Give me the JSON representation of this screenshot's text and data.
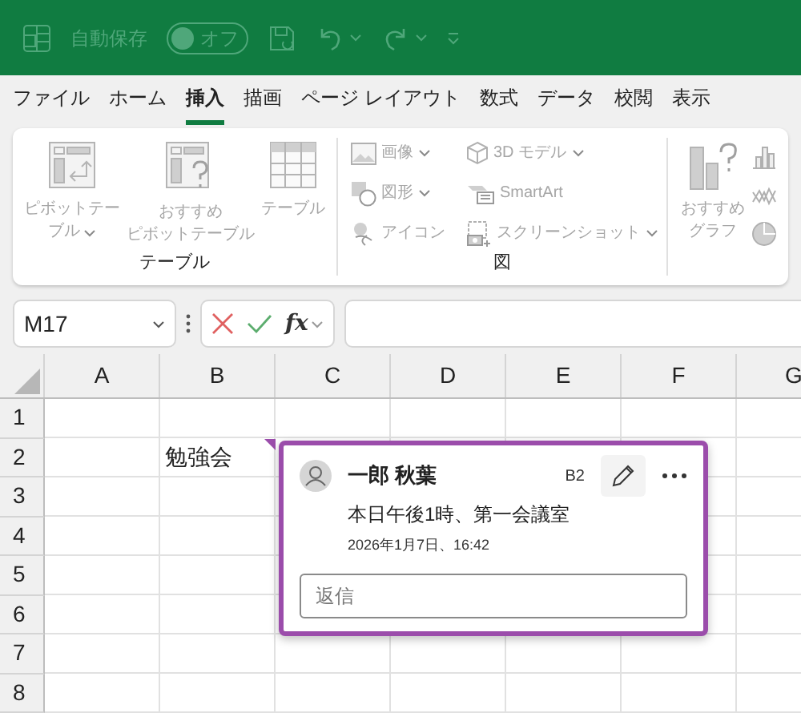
{
  "title_bar": {
    "autosave_label": "自動保存",
    "autosave_toggle": {
      "label": "オフ",
      "on": false
    }
  },
  "menu_tabs": [
    {
      "label": "ファイル",
      "selected": false
    },
    {
      "label": "ホーム",
      "selected": false
    },
    {
      "label": "挿入",
      "selected": true
    },
    {
      "label": "描画",
      "selected": false
    },
    {
      "label": "ページ レイアウト",
      "selected": false
    },
    {
      "label": "数式",
      "selected": false
    },
    {
      "label": "データ",
      "selected": false
    },
    {
      "label": "校閲",
      "selected": false
    },
    {
      "label": "表示",
      "selected": false
    }
  ],
  "ribbon": {
    "table_group": {
      "label": "テーブル",
      "buttons": [
        {
          "kind": "pivot",
          "lines": [
            "ピボットテー",
            "ブル"
          ],
          "dropdown": true,
          "disabled": true
        },
        {
          "kind": "recommended-pivot",
          "lines": [
            "おすすめ",
            "ピボットテーブル"
          ],
          "disabled": true
        },
        {
          "kind": "table",
          "lines": [
            "テーブル"
          ],
          "disabled": true
        }
      ]
    },
    "illustrations_group": {
      "label": "図",
      "items": [
        {
          "kind": "image",
          "label": "画像",
          "dropdown": true,
          "disabled": true
        },
        {
          "kind": "model",
          "label": "3D モデル",
          "dropdown": true,
          "disabled": true
        },
        {
          "kind": "shape",
          "label": "図形",
          "dropdown": true,
          "disabled": true
        },
        {
          "kind": "smartart",
          "label": "SmartArt",
          "disabled": true
        },
        {
          "kind": "icons",
          "label": "アイコン",
          "disabled": true
        },
        {
          "kind": "screenshot",
          "label": "スクリーンショット",
          "dropdown": true,
          "disabled": true
        }
      ]
    },
    "charts_group": {
      "recommended": {
        "lines": [
          "おすすめ",
          "グラフ"
        ],
        "disabled": true
      }
    }
  },
  "formula_bar": {
    "name_box": "M17",
    "function_label": "fx"
  },
  "sheet": {
    "columns": [
      "A",
      "B",
      "C",
      "D",
      "E",
      "F",
      "G"
    ],
    "rows": [
      {
        "label": "1",
        "cells": [
          "",
          "",
          "",
          "",
          "",
          "",
          ""
        ]
      },
      {
        "label": "2",
        "cells": [
          "",
          "勉強会",
          "",
          "",
          "",
          "",
          ""
        ]
      },
      {
        "label": "3",
        "cells": [
          "",
          "",
          "",
          "",
          "",
          "",
          ""
        ]
      },
      {
        "label": "4",
        "cells": [
          "",
          "",
          "",
          "",
          "",
          "",
          ""
        ]
      },
      {
        "label": "5",
        "cells": [
          "",
          "",
          "",
          "",
          "",
          "",
          ""
        ]
      },
      {
        "label": "6",
        "cells": [
          "",
          "",
          "",
          "",
          "",
          "",
          ""
        ]
      },
      {
        "label": "7",
        "cells": [
          "",
          "",
          "",
          "",
          "",
          "",
          ""
        ]
      },
      {
        "label": "8",
        "cells": [
          "",
          "",
          "",
          "",
          "",
          "",
          ""
        ]
      }
    ]
  },
  "comment": {
    "author": "一郎 秋葉",
    "cell_ref": "B2",
    "body": "本日午後1時、第一会議室",
    "timestamp": "2026年1月7日、16:42",
    "reply": {
      "placeholder": "返信"
    }
  }
}
